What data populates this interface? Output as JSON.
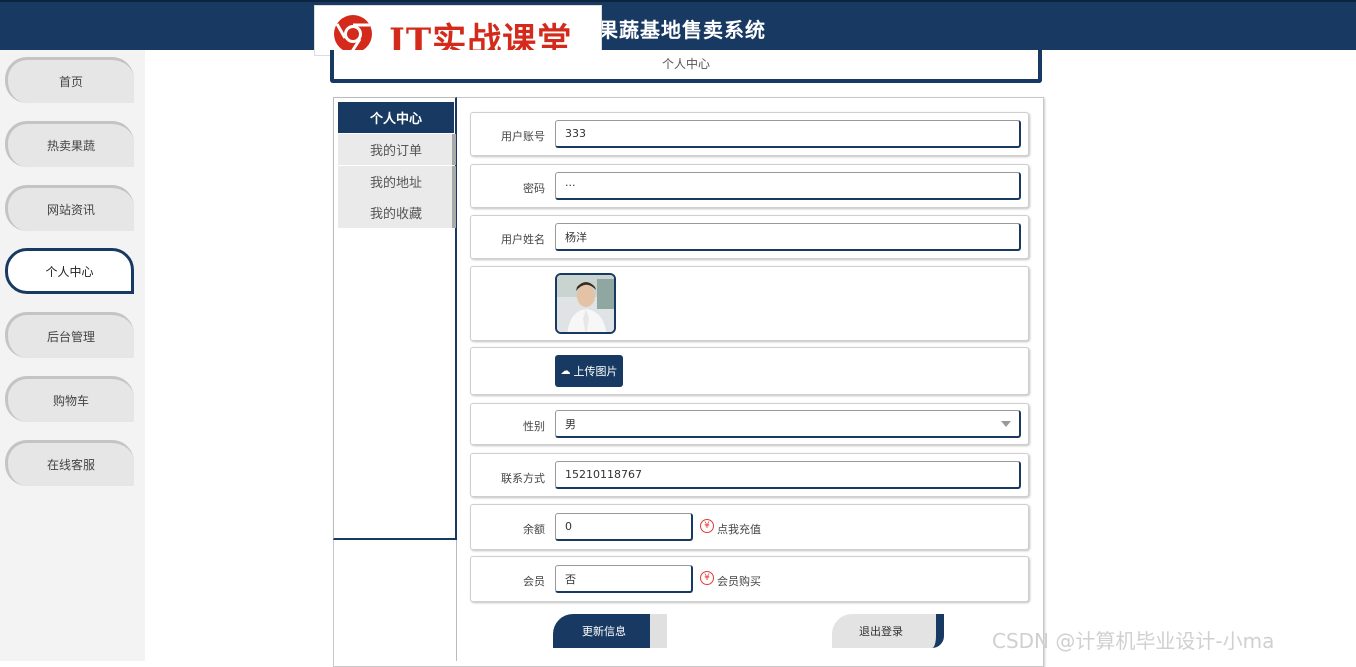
{
  "header": {
    "title": "果蔬基地售卖系统",
    "logo_text": "IT实战课堂"
  },
  "sidebar": {
    "items": [
      {
        "label": "首页"
      },
      {
        "label": "热卖果蔬"
      },
      {
        "label": "网站资讯"
      },
      {
        "label": "个人中心"
      },
      {
        "label": "后台管理"
      },
      {
        "label": "购物车"
      },
      {
        "label": "在线客服"
      }
    ],
    "active_index": 3
  },
  "page": {
    "section_title": "个人中心"
  },
  "left_nav": {
    "items": [
      {
        "label": "个人中心"
      },
      {
        "label": "我的订单"
      },
      {
        "label": "我的地址"
      },
      {
        "label": "我的收藏"
      }
    ]
  },
  "form": {
    "username": {
      "label": "用户账号",
      "value": "333"
    },
    "password": {
      "label": "密码",
      "value": "···"
    },
    "realname": {
      "label": "用户姓名",
      "value": "杨洋"
    },
    "upload": {
      "label": "上传图片"
    },
    "gender": {
      "label": "性别",
      "value": "男"
    },
    "phone": {
      "label": "联系方式",
      "value": "15210118767"
    },
    "balance": {
      "label": "余额",
      "value": "0",
      "action": "点我充值"
    },
    "member": {
      "label": "会员",
      "value": "否",
      "action": "会员购买"
    }
  },
  "actions": {
    "update_label": "更新信息",
    "logout_label": "退出登录"
  },
  "watermark": "CSDN @计算机毕业设计-小ma",
  "colors": {
    "primary": "#183a62",
    "accent_red": "#e53b3b",
    "logo_red": "#d42a1c"
  }
}
